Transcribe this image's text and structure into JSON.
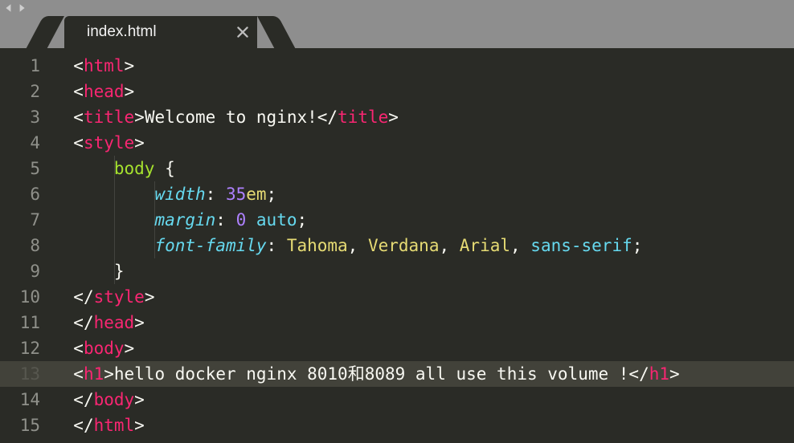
{
  "tab": {
    "filename": "index.html"
  },
  "gutter": [
    "1",
    "2",
    "3",
    "4",
    "5",
    "6",
    "7",
    "8",
    "9",
    "10",
    "11",
    "12",
    "13",
    "14",
    "15"
  ],
  "code": {
    "active_line_index": 12,
    "lines": [
      {
        "indent": 0,
        "tokens": [
          {
            "t": "<",
            "c": "punct"
          },
          {
            "t": "html",
            "c": "tag"
          },
          {
            "t": ">",
            "c": "punct"
          }
        ]
      },
      {
        "indent": 0,
        "tokens": [
          {
            "t": "<",
            "c": "punct"
          },
          {
            "t": "head",
            "c": "tag"
          },
          {
            "t": ">",
            "c": "punct"
          }
        ]
      },
      {
        "indent": 0,
        "tokens": [
          {
            "t": "<",
            "c": "punct"
          },
          {
            "t": "title",
            "c": "tag"
          },
          {
            "t": ">",
            "c": "punct"
          },
          {
            "t": "Welcome to nginx!",
            "c": "text"
          },
          {
            "t": "</",
            "c": "punct"
          },
          {
            "t": "title",
            "c": "tag"
          },
          {
            "t": ">",
            "c": "punct"
          }
        ]
      },
      {
        "indent": 0,
        "tokens": [
          {
            "t": "<",
            "c": "punct"
          },
          {
            "t": "style",
            "c": "tag"
          },
          {
            "t": ">",
            "c": "punct"
          }
        ]
      },
      {
        "indent": 1,
        "tokens": [
          {
            "t": "body",
            "c": "sel"
          },
          {
            "t": " {",
            "c": "punct"
          }
        ]
      },
      {
        "indent": 2,
        "tokens": [
          {
            "t": "width",
            "c": "prop"
          },
          {
            "t": ": ",
            "c": "punct"
          },
          {
            "t": "35",
            "c": "num"
          },
          {
            "t": "em",
            "c": "kw"
          },
          {
            "t": ";",
            "c": "punct"
          }
        ]
      },
      {
        "indent": 2,
        "tokens": [
          {
            "t": "margin",
            "c": "prop"
          },
          {
            "t": ": ",
            "c": "punct"
          },
          {
            "t": "0",
            "c": "num"
          },
          {
            "t": " ",
            "c": "punct"
          },
          {
            "t": "auto",
            "c": "val"
          },
          {
            "t": ";",
            "c": "punct"
          }
        ]
      },
      {
        "indent": 2,
        "tokens": [
          {
            "t": "font-family",
            "c": "prop"
          },
          {
            "t": ": ",
            "c": "punct"
          },
          {
            "t": "Tahoma",
            "c": "kw"
          },
          {
            "t": ", ",
            "c": "punct"
          },
          {
            "t": "Verdana",
            "c": "kw"
          },
          {
            "t": ", ",
            "c": "punct"
          },
          {
            "t": "Arial",
            "c": "kw"
          },
          {
            "t": ", ",
            "c": "punct"
          },
          {
            "t": "sans-serif",
            "c": "val"
          },
          {
            "t": ";",
            "c": "punct"
          }
        ]
      },
      {
        "indent": 1,
        "tokens": [
          {
            "t": "}",
            "c": "punct"
          }
        ]
      },
      {
        "indent": 0,
        "tokens": [
          {
            "t": "</",
            "c": "punct"
          },
          {
            "t": "style",
            "c": "tag"
          },
          {
            "t": ">",
            "c": "punct"
          }
        ]
      },
      {
        "indent": 0,
        "tokens": [
          {
            "t": "</",
            "c": "punct"
          },
          {
            "t": "head",
            "c": "tag"
          },
          {
            "t": ">",
            "c": "punct"
          }
        ]
      },
      {
        "indent": 0,
        "tokens": [
          {
            "t": "<",
            "c": "punct"
          },
          {
            "t": "body",
            "c": "tag"
          },
          {
            "t": ">",
            "c": "punct"
          }
        ]
      },
      {
        "indent": 0,
        "tokens": [
          {
            "t": "<",
            "c": "punct"
          },
          {
            "t": "h1",
            "c": "tag"
          },
          {
            "t": ">",
            "c": "punct"
          },
          {
            "t": "hello docker nginx 8010和8089 all use this volume !",
            "c": "text"
          },
          {
            "t": "</",
            "c": "punct"
          },
          {
            "t": "h1",
            "c": "tag"
          },
          {
            "t": ">",
            "c": "punct"
          }
        ]
      },
      {
        "indent": 0,
        "tokens": [
          {
            "t": "</",
            "c": "punct"
          },
          {
            "t": "body",
            "c": "tag"
          },
          {
            "t": ">",
            "c": "punct"
          }
        ]
      },
      {
        "indent": 0,
        "tokens": [
          {
            "t": "</",
            "c": "punct"
          },
          {
            "t": "html",
            "c": "tag"
          },
          {
            "t": ">",
            "c": "punct"
          }
        ]
      }
    ]
  },
  "indent_unit_ch": 4,
  "left_pad_ch": 2
}
